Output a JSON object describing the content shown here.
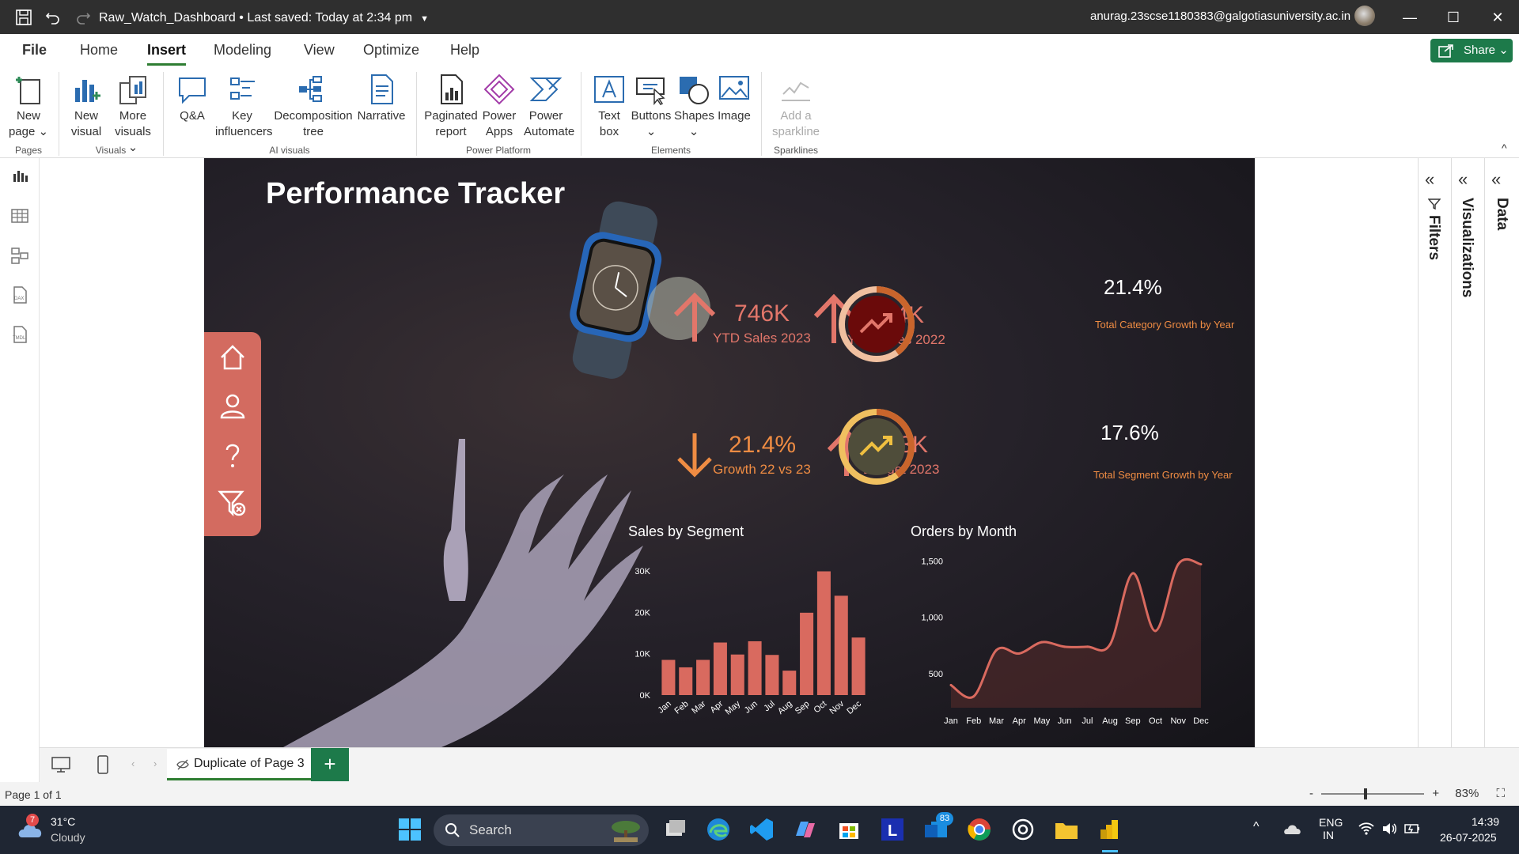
{
  "titlebar": {
    "doc_name": "Raw_Watch_Dashboard",
    "save_status": "• Last saved: Today at 2:34 pm",
    "account": "anurag.23scse1180383@galgotiasuniversity.ac.in"
  },
  "menu": {
    "tabs": [
      "File",
      "Home",
      "Insert",
      "Modeling",
      "View",
      "Optimize",
      "Help"
    ],
    "active": "Insert",
    "share_label": "Share"
  },
  "ribbon": {
    "buttons": {
      "new_page": [
        "New",
        "page"
      ],
      "new_visual": [
        "New",
        "visual"
      ],
      "more_visuals": [
        "More",
        "visuals"
      ],
      "qa": [
        "Q&A"
      ],
      "key_influencers": [
        "Key",
        "influencers"
      ],
      "decomposition_tree": [
        "Decomposition",
        "tree"
      ],
      "narrative": [
        "Narrative"
      ],
      "paginated_report": [
        "Paginated",
        "report"
      ],
      "power_apps": [
        "Power",
        "Apps"
      ],
      "power_automate": [
        "Power",
        "Automate"
      ],
      "text_box": [
        "Text",
        "box"
      ],
      "buttons": [
        "Buttons"
      ],
      "shapes": [
        "Shapes"
      ],
      "image": [
        "Image"
      ],
      "add_sparkline": [
        "Add a",
        "sparkline"
      ]
    },
    "groups": {
      "pages": "Pages",
      "visuals": "Visuals",
      "ai_visuals": "AI visuals",
      "power_platform": "Power Platform",
      "elements": "Elements",
      "sparklines": "Sparklines"
    }
  },
  "report": {
    "title": "Performance Tracker",
    "kpis": [
      {
        "value": "746K",
        "label": "YTD Sales 2023",
        "trend": "up"
      },
      {
        "value": "614K",
        "label": "YTD Sales 2022",
        "trend": "up"
      },
      {
        "value": "21.4%",
        "label": "Growth 22 vs 23",
        "trend": "down"
      },
      {
        "value": "473K",
        "label": "Budget 2023",
        "trend": "up"
      }
    ],
    "rings": [
      {
        "value": "21.4%",
        "label": "Total Category Growth by Year",
        "fill": 0.4
      },
      {
        "value": "17.6%",
        "label": "Total Segment Growth by Year",
        "fill": 0.4
      }
    ]
  },
  "chart_data": [
    {
      "type": "bar",
      "title": "Sales by Segment",
      "categories": [
        "Jan",
        "Feb",
        "Mar",
        "Apr",
        "May",
        "Jun",
        "Jul",
        "Aug",
        "Sep",
        "Oct",
        "Nov",
        "Dec"
      ],
      "values": [
        8500,
        6700,
        8500,
        12700,
        9800,
        13000,
        9700,
        5900,
        19900,
        29900,
        24000,
        13900
      ],
      "ylim": [
        0,
        30000
      ],
      "yticks": [
        "0K",
        "10K",
        "20K",
        "30K"
      ],
      "color": "#d96a5f"
    },
    {
      "type": "area",
      "title": "Orders by Month",
      "categories": [
        "Jan",
        "Feb",
        "Mar",
        "Apr",
        "May",
        "Jun",
        "Jul",
        "Aug",
        "Sep",
        "Oct",
        "Nov",
        "Dec"
      ],
      "values": [
        400,
        300,
        710,
        680,
        780,
        740,
        740,
        760,
        1390,
        880,
        1470,
        1470
      ],
      "ylim": [
        200,
        1600
      ],
      "yticks": [
        "500",
        "1,000",
        "1,500"
      ],
      "color": "#d96a5f"
    }
  ],
  "pagebar": {
    "tab": "Duplicate of Page 3",
    "add": "+"
  },
  "status": {
    "page": "Page 1 of 1",
    "zoom": "83%",
    "minus": "-",
    "plus": "+"
  },
  "panes": {
    "filters": "Filters",
    "visualizations": "Visualizations",
    "data": "Data"
  },
  "taskbar": {
    "weather_temp": "31°C",
    "weather_desc": "Cloudy",
    "weather_badge": "7",
    "search": "Search",
    "lang1": "ENG",
    "lang2": "IN",
    "time": "14:39",
    "date": "26-07-2025",
    "badge_83": "83"
  }
}
